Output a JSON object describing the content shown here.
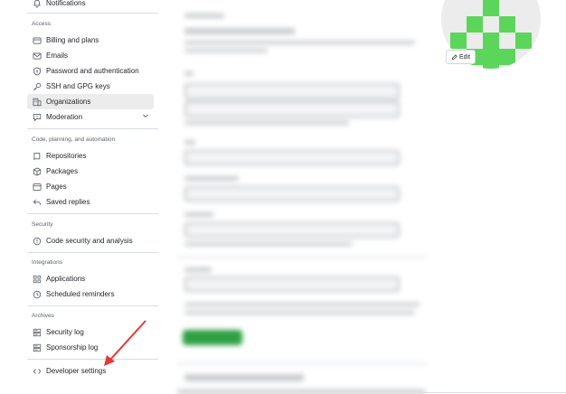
{
  "sidebar": {
    "top_item": {
      "label": "Notifications",
      "icon": "bell-icon"
    },
    "sections": [
      {
        "heading": "Access",
        "items": [
          {
            "label": "Billing and plans",
            "icon": "credit-card-icon"
          },
          {
            "label": "Emails",
            "icon": "mail-icon"
          },
          {
            "label": "Password and authentication",
            "icon": "shield-lock-icon"
          },
          {
            "label": "SSH and GPG keys",
            "icon": "key-icon"
          },
          {
            "label": "Organizations",
            "icon": "organization-icon",
            "active": true
          },
          {
            "label": "Moderation",
            "icon": "report-icon",
            "expandable": true
          }
        ]
      },
      {
        "heading": "Code, planning, and automation",
        "items": [
          {
            "label": "Repositories",
            "icon": "repo-icon"
          },
          {
            "label": "Packages",
            "icon": "package-icon"
          },
          {
            "label": "Pages",
            "icon": "browser-icon"
          },
          {
            "label": "Saved replies",
            "icon": "reply-icon"
          }
        ]
      },
      {
        "heading": "Security",
        "items": [
          {
            "label": "Code security and analysis",
            "icon": "shield-icon"
          }
        ]
      },
      {
        "heading": "Integrations",
        "items": [
          {
            "label": "Applications",
            "icon": "apps-icon"
          },
          {
            "label": "Scheduled reminders",
            "icon": "clock-icon"
          }
        ]
      },
      {
        "heading": "Archives",
        "items": [
          {
            "label": "Security log",
            "icon": "log-icon"
          },
          {
            "label": "Sponsorship log",
            "icon": "log-icon"
          }
        ]
      }
    ],
    "developer_settings": {
      "label": "Developer settings",
      "icon": "code-icon"
    }
  },
  "avatar": {
    "edit_label": "Edit",
    "identicon_color": "#5bd65b"
  },
  "annotation": {
    "arrow_color": "#e53935"
  },
  "colors": {
    "active_item_bg": "#ececec",
    "primary_button": "#2ea043"
  }
}
